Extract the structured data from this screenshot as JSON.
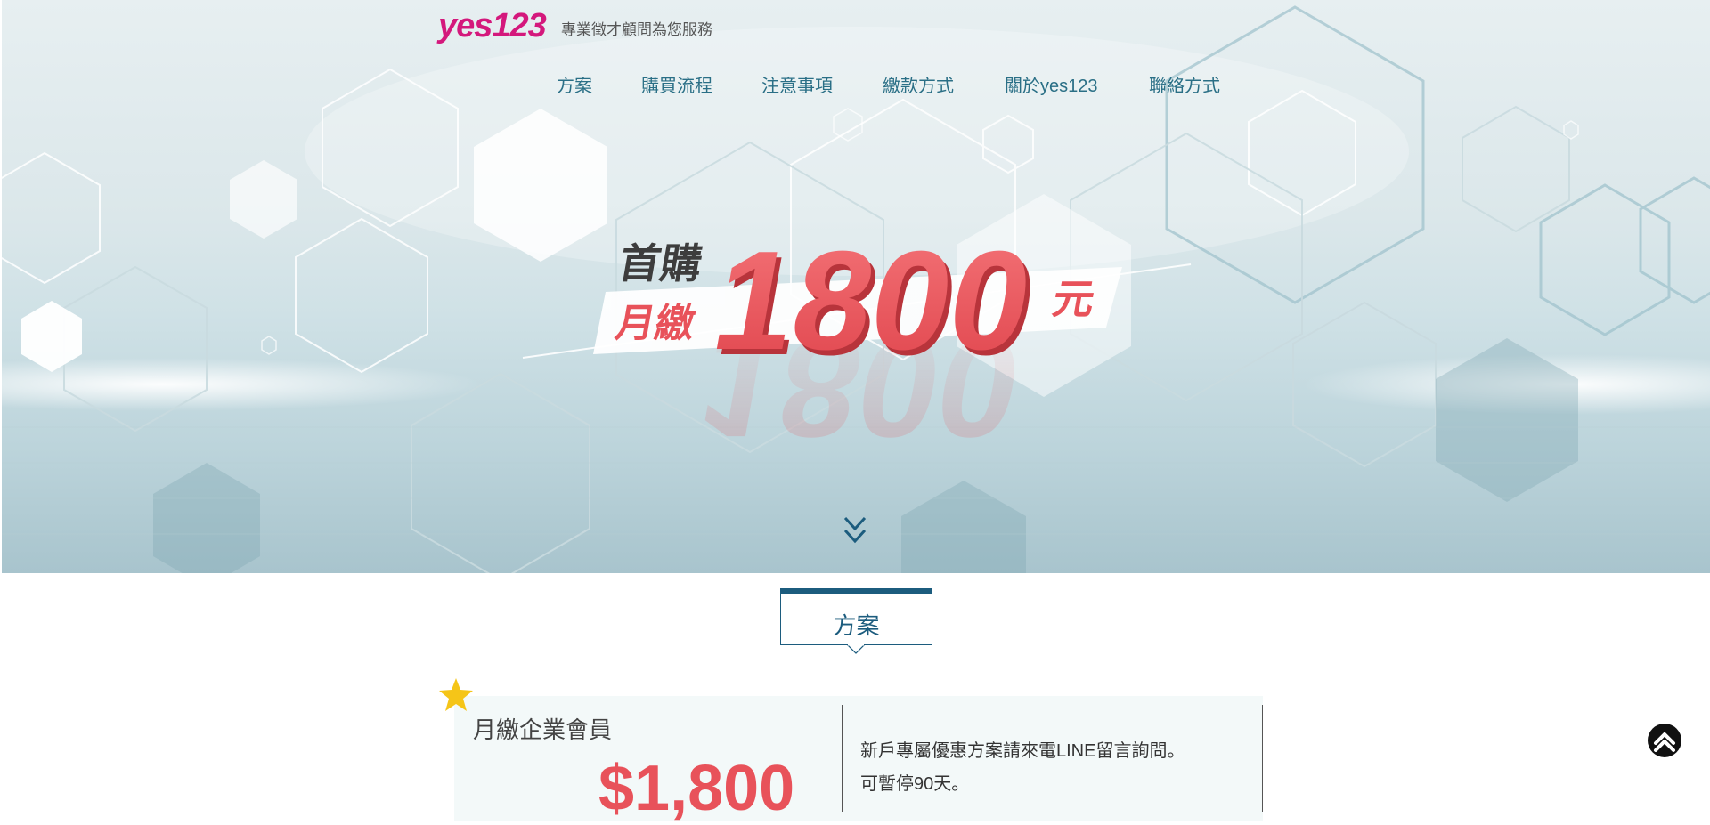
{
  "header": {
    "logo_text": "yes123",
    "tagline": "專業徵才顧問為您服務",
    "logo_color": "#d4187c"
  },
  "nav": {
    "items": [
      {
        "label": "方案"
      },
      {
        "label": "購買流程"
      },
      {
        "label": "注意事項"
      },
      {
        "label": "繳款方式"
      },
      {
        "label": "關於yes123"
      },
      {
        "label": "聯絡方式"
      }
    ],
    "color": "#2a6f86"
  },
  "hero": {
    "line1": "首購",
    "line2": "月繳",
    "amount": "1800",
    "unit": "元",
    "accent": "#e8525a"
  },
  "section": {
    "title": "方案"
  },
  "plan": {
    "title": "月繳企業會員",
    "price": "$1,800",
    "descriptions": [
      "新戶專屬優惠方案請來電LINE留言詢問。",
      "可暫停90天。"
    ]
  },
  "icons": {
    "scroll_down": "double-chevron-down-icon",
    "star": "star-icon",
    "scroll_top": "arrow-up-circle-icon"
  }
}
